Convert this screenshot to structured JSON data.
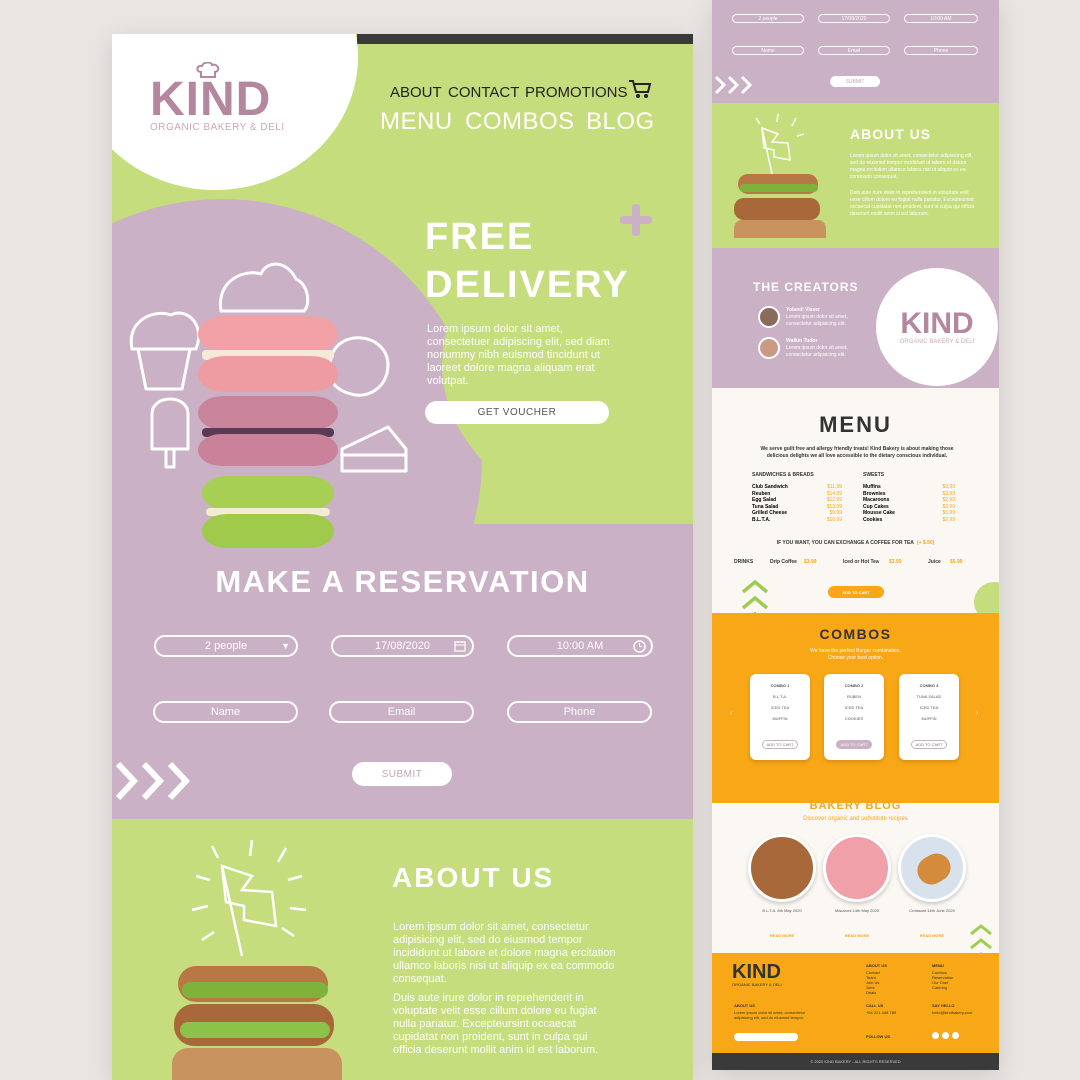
{
  "brand": {
    "name": "KIND",
    "tagline": "ORGANIC BAKERY & DELI"
  },
  "nav": {
    "top": [
      "ABOUT",
      "CONTACT",
      "PROMOTIONS"
    ],
    "main": [
      "MENU",
      "COMBOS",
      "BLOG"
    ]
  },
  "hero": {
    "title_line1": "FREE",
    "title_line2": "DELIVERY",
    "body": "Lorem ipsum dolor sit amet, consectetuer adipiscing elit, sed diam nonummy nibh euismod tincidunt ut laoreet dolore magna aliquam erat volutpat.",
    "cta": "GET VOUCHER"
  },
  "reservation": {
    "title": "MAKE A RESERVATION",
    "people": "2 people",
    "date": "17/08/2020",
    "time": "10:00 AM",
    "name_placeholder": "Name",
    "email_placeholder": "Email",
    "phone_placeholder": "Phone",
    "submit": "SUBMIT"
  },
  "about": {
    "title": "ABOUT US",
    "p1": "Lorem ipsum dolor sit amet, consectetur adipisicing elit, sed do eiusmod tempor incididunt ut labore et dolore magna ercitation ullamco laboris nisi ut aliquip ex ea commodo consequat.",
    "p2": "Duis aute irure dolor in reprehenderit in voluptate velit esse cillum dolore eu fugiat nulla pariatur. Excepteursint occaecat cupidatat non proident, sunt in culpa qui officia deserunt mollit anim id est laborum."
  },
  "right": {
    "res": {
      "people": "2 people",
      "date": "17/08/2020",
      "time": "10:00 AM",
      "name": "Name",
      "email": "Email",
      "phone": "Phone",
      "submit": "SUBMIT"
    },
    "about_title": "ABOUT US",
    "about_p1": "Lorem ipsum dolor sit amet, consectetur adipisicing elit, sed do eiusmod tempor incididunt ut labore et dolore magna ercitation ullamco laboris nisi ut aliquip ex ea commodo consequat.",
    "about_p2": "Duis aute irure dolor in reprehenderit in voluptate velit esse cillum dolore eu fugiat nulla pariatur. Excepteursint occaecat cupidatat non proident, sunt in culpa qui officia deserunt mollit anim id est laborum.",
    "creators_title": "THE CREATORS",
    "creators": [
      {
        "name": "Yolandi Visser",
        "bio": "Lorem ipsum dolor sit amet, consectetur adipisicing elit."
      },
      {
        "name": "Watkin Tudor",
        "bio": "Lorem ipsum dolor sit amet, consectetur adipisicing elit."
      }
    ],
    "menu_title": "MENU",
    "menu_intro": "We serve guilt free and allergy friendly treats! Kind Bakery is about making those delicious delights we all love accessible to the dietary conscious individual.",
    "sandwiches_title": "SANDWICHES & BREADS",
    "sandwiches": [
      {
        "item": "Club Sandwich",
        "price": "$11.99"
      },
      {
        "item": "Reuben",
        "price": "$14.99"
      },
      {
        "item": "Egg Salad",
        "price": "$12.99"
      },
      {
        "item": "Tuna Salad",
        "price": "$13.99"
      },
      {
        "item": "Grilled Cheese",
        "price": "$9.99"
      },
      {
        "item": "B.L.T.A.",
        "price": "$10.99"
      }
    ],
    "sweets_title": "SWEETS",
    "sweets": [
      {
        "item": "Muffins",
        "price": "$3.99"
      },
      {
        "item": "Brownies",
        "price": "$3.99"
      },
      {
        "item": "Macaroons",
        "price": "$2.99"
      },
      {
        "item": "Cup Cakes",
        "price": "$3.99"
      },
      {
        "item": "Mousse Cake",
        "price": "$5.99"
      },
      {
        "item": "Cookies",
        "price": "$2.99"
      }
    ],
    "exchange_note": "IF YOU WANT, YOU CAN EXCHANGE A COFFEE FOR TEA",
    "exchange_price": "(+ $.50)",
    "drinks_label": "DRINKS",
    "drinks": [
      {
        "item": "Drip Coffee",
        "price": "$3.99"
      },
      {
        "item": "Iced or Hot Tea",
        "price": "$3.99"
      },
      {
        "item": "Juice",
        "price": "$5.99"
      }
    ],
    "add_to_cart": "ADD TO CART",
    "combos_title": "COMBOS",
    "combos_sub1": "We have the perfect Burger combination.",
    "combos_sub2": "Choose your best option.",
    "combos": [
      {
        "title": "COMBO 1",
        "items": [
          "B.L.T.A.",
          "ICED TEA",
          "MUFFIN"
        ]
      },
      {
        "title": "COMBO 2",
        "items": [
          "RUBEN",
          "ICED TEA",
          "COOKIES"
        ]
      },
      {
        "title": "COMBO 3",
        "items": [
          "TUNA SALAD",
          "ICED TEA",
          "MUFFIN"
        ]
      }
    ],
    "combo_cta": "ADD TO CART",
    "blog_title": "BAKERY BLOG",
    "blog_sub": "Discover organic and substitute recipes",
    "blog_captions": [
      "B.L.T.A. 8th May 2020",
      "Macaroni 14th May 2020",
      "Croissant 14th June 2020"
    ],
    "read_more": "READ MORE",
    "footer": {
      "about_label": "ABOUT US",
      "about_text": "Lorem ipsum dolor sit amet, consectetur adipisicing elit, sed do eiusmod tempor.",
      "about_col": "ABOUT US",
      "about_links": [
        "Contact",
        "Team",
        "Join Us",
        "Jobs",
        "Deals"
      ],
      "menu_col": "MENU",
      "menu_links": [
        "Combos",
        "Reservation",
        "Our Chef",
        "Catering"
      ],
      "call_us": "CALL US",
      "phone": "+54 221 448 789",
      "say_hello": "SAY HELLO",
      "email": "hello@kindbakery.com",
      "follow_us": "FOLLOW US",
      "copyright": "© 2020 KIND BAKERY - ALL RIGHTS RESERVED"
    }
  },
  "colors": {
    "green": "#c6dd7d",
    "pink": "#cbb1c5",
    "orange": "#f8a716",
    "mauve_text": "#b4879f",
    "cream": "#fbf8f3"
  }
}
